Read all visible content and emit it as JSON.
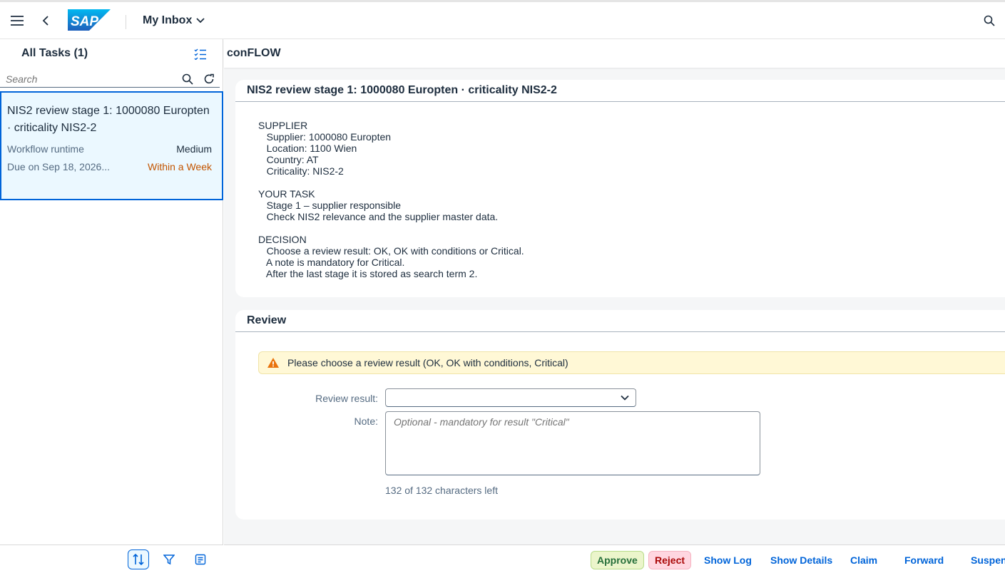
{
  "shell": {
    "logo_text": "SAP",
    "title": "My Inbox"
  },
  "master": {
    "title": "All Tasks (1)",
    "search_placeholder": "Search",
    "tasks": [
      {
        "title": "NIS2 review stage 1: 1000080 Europten · criticality NIS2-2",
        "type": "Workflow runtime",
        "priority": "Medium",
        "due": "Due on Sep 18, 2026...",
        "status": "Within a Week"
      }
    ]
  },
  "detail": {
    "header": "conFLOW",
    "description_title": "NIS2 review stage 1: 1000080 Europten · criticality NIS2-2",
    "description_text": "SUPPLIER\n   Supplier: 1000080 Europten\n   Location: 1100 Wien\n   Country: AT\n   Criticality: NIS2-2\n\nYOUR TASK\n   Stage 1 – supplier responsible\n   Check NIS2 relevance and the supplier master data.\n\nDECISION\n   Choose a review result: OK, OK with conditions or Critical.\n   A note is mandatory for Critical.\n   After the last stage it is stored as search term 2.",
    "review": {
      "title": "Review",
      "warning": "Please choose a review result (OK, OK with conditions, Critical)",
      "result_label": "Review result:",
      "result_value": "",
      "note_label": "Note:",
      "note_placeholder": "Optional - mandatory for result \"Critical\"",
      "counter": "132 of 132 characters left"
    }
  },
  "footer": {
    "approve": "Approve",
    "reject": "Reject",
    "show_log": "Show Log",
    "show_details": "Show Details",
    "claim": "Claim",
    "forward": "Forward",
    "suspend": "Suspend"
  },
  "colors": {
    "brand": "#0064d9",
    "warning": "#e9730c",
    "due_status": "#c35500",
    "approve_bg": "#ebf5cb",
    "reject_bg": "#ffd6e0"
  },
  "icons": [
    "menu-icon",
    "back-icon",
    "chevron-down-icon",
    "search-icon",
    "multi-select-icon",
    "refresh-icon",
    "sort-icon",
    "filter-icon",
    "group-icon",
    "warning-icon"
  ]
}
